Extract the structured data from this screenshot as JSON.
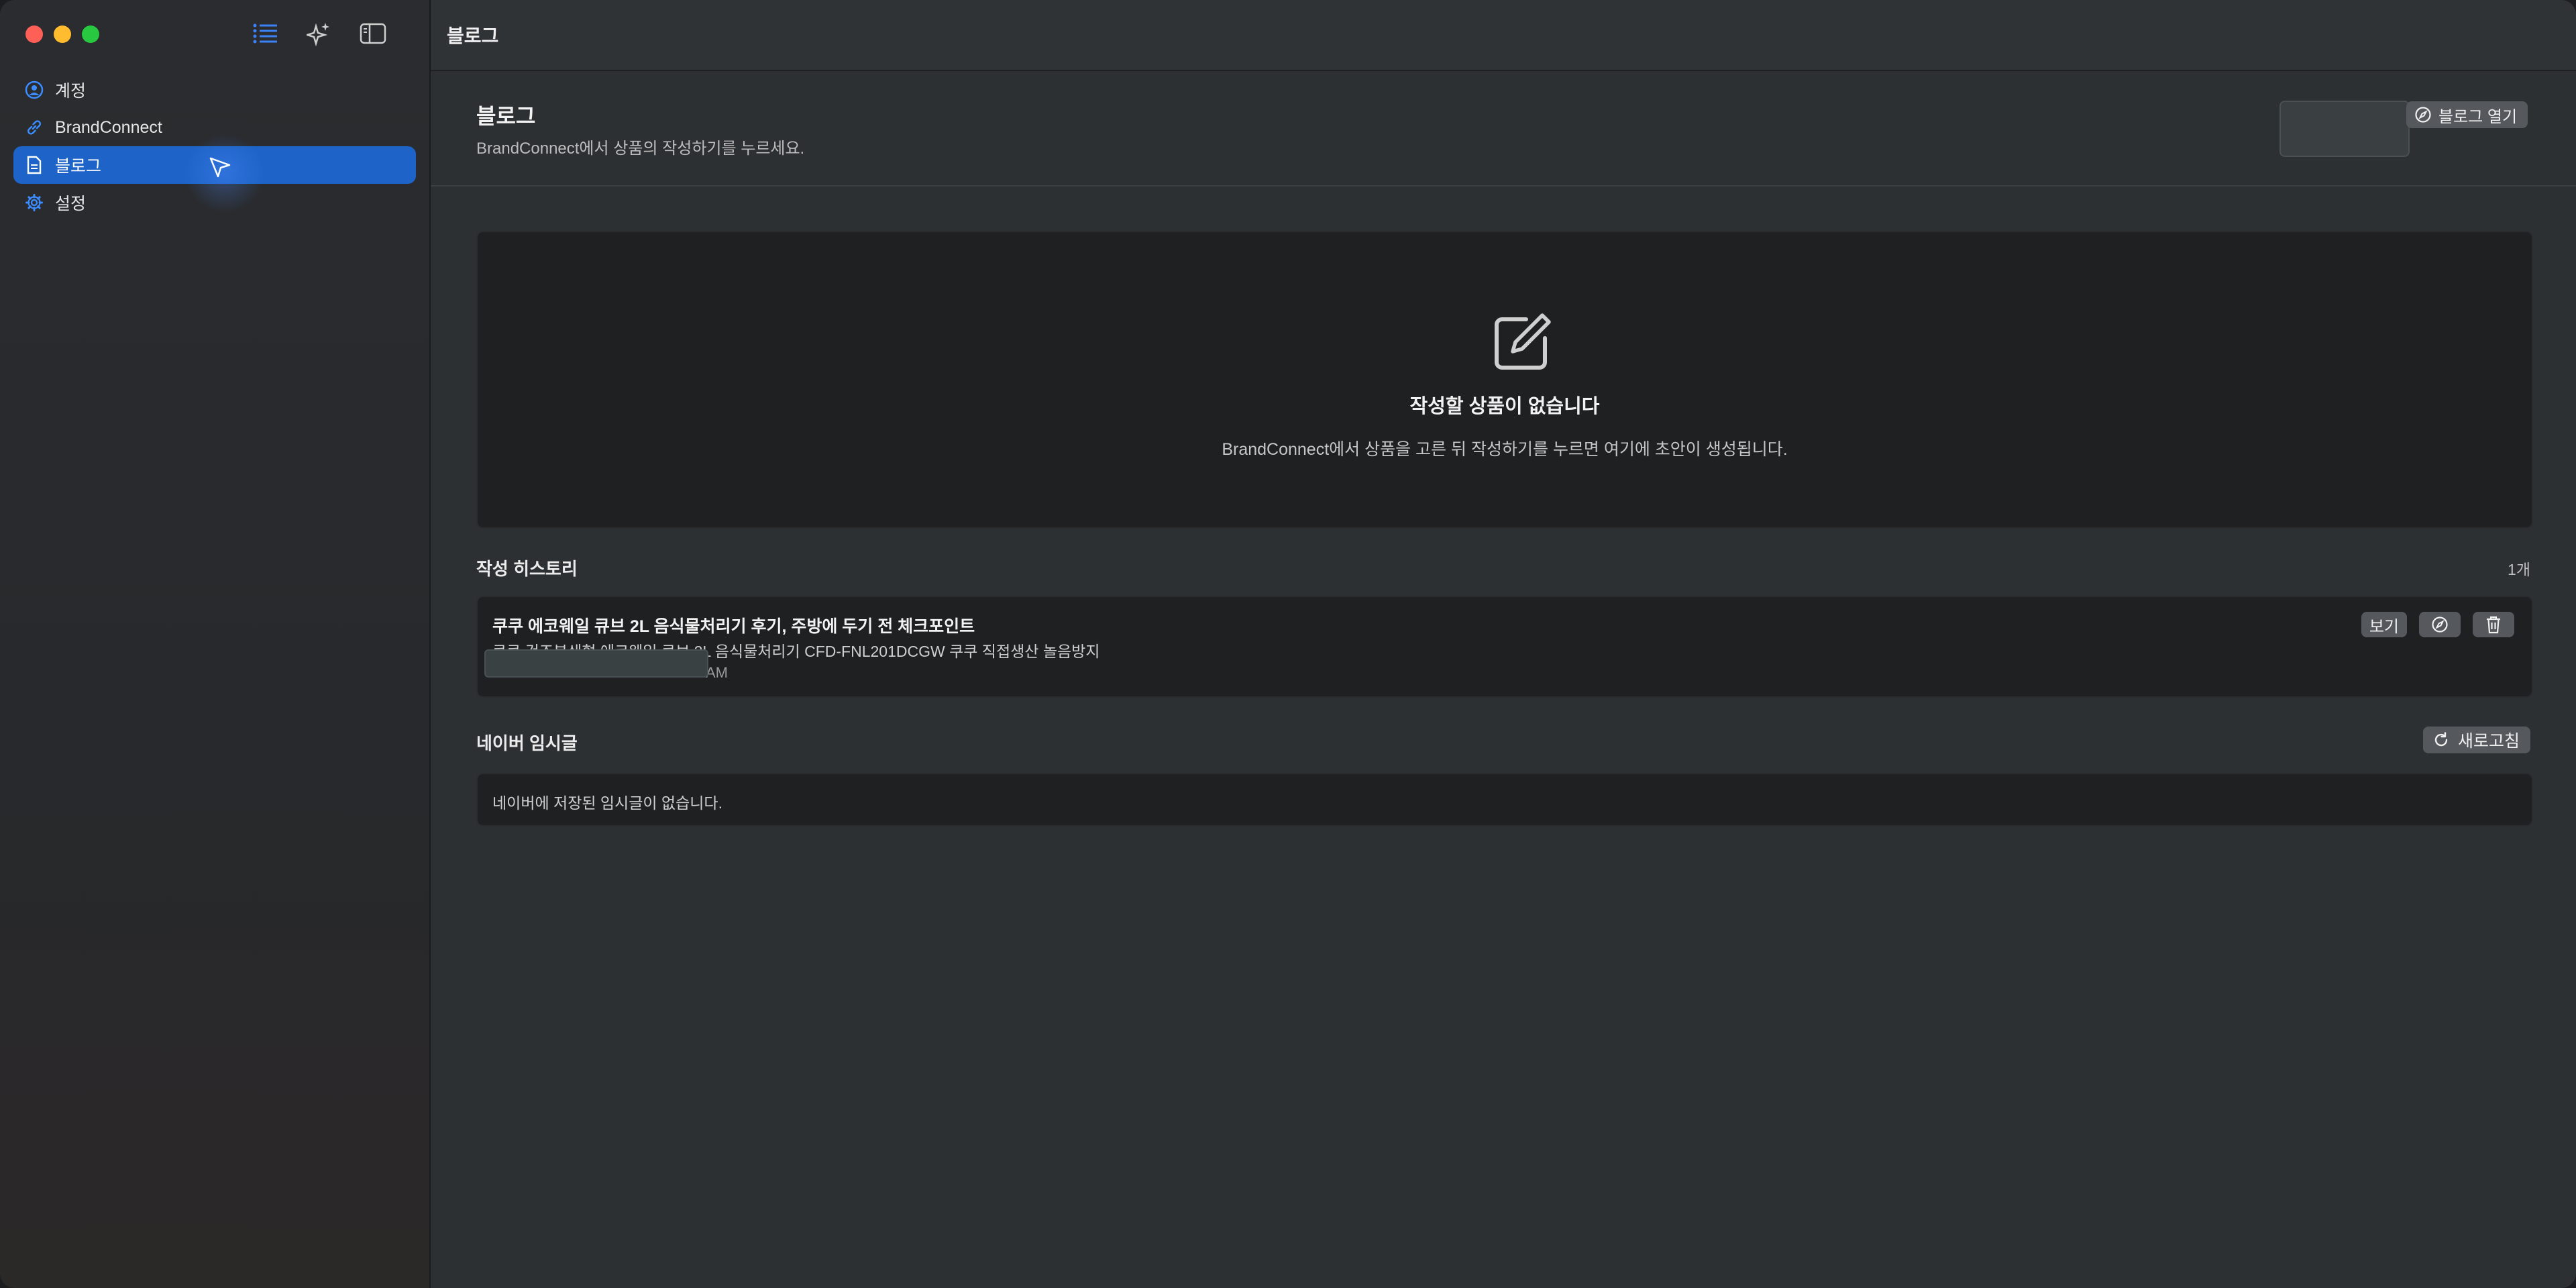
{
  "sidebar": {
    "items": [
      {
        "label": "계정",
        "icon": "person-circle-icon"
      },
      {
        "label": "BrandConnect",
        "icon": "link-icon"
      },
      {
        "label": "블로그",
        "icon": "document-icon"
      },
      {
        "label": "설정",
        "icon": "gear-icon"
      }
    ],
    "selected": "블로그"
  },
  "topbar": {
    "title": "블로그"
  },
  "header": {
    "title": "블로그",
    "subtitle": "BrandConnect에서 상품의 작성하기를 누르세요.",
    "open_button": "블로그 열기"
  },
  "empty_state": {
    "title": "작성할 상품이 없습니다",
    "description": "BrandConnect에서 상품을 고른 뒤 작성하기를 누르면 여기에 초안이 생성됩니다."
  },
  "history": {
    "title": "작성 히스토리",
    "count": "1개",
    "items": [
      {
        "title": "쿠쿠 에코웨일 큐브 2L 음식물처리기 후기, 주방에 두기 전 체크포인트",
        "description": "쿠쿠 건조분쇄형 에코웨일 큐브 2L 음식물처리기 CFD-FNL201DCGW 쿠쿠 직접생산 놀음방지",
        "date": "AM",
        "view_button": "보기"
      }
    ]
  },
  "drafts": {
    "title": "네이버 임시글",
    "refresh_button": "새로고침",
    "empty_text": "네이버에 저장된 임시글이 없습니다."
  },
  "colors": {
    "accent": "#1e64c8",
    "window_bg": "#2d3033",
    "panel_bg": "#1f2022",
    "button_bg": "#55595d"
  }
}
